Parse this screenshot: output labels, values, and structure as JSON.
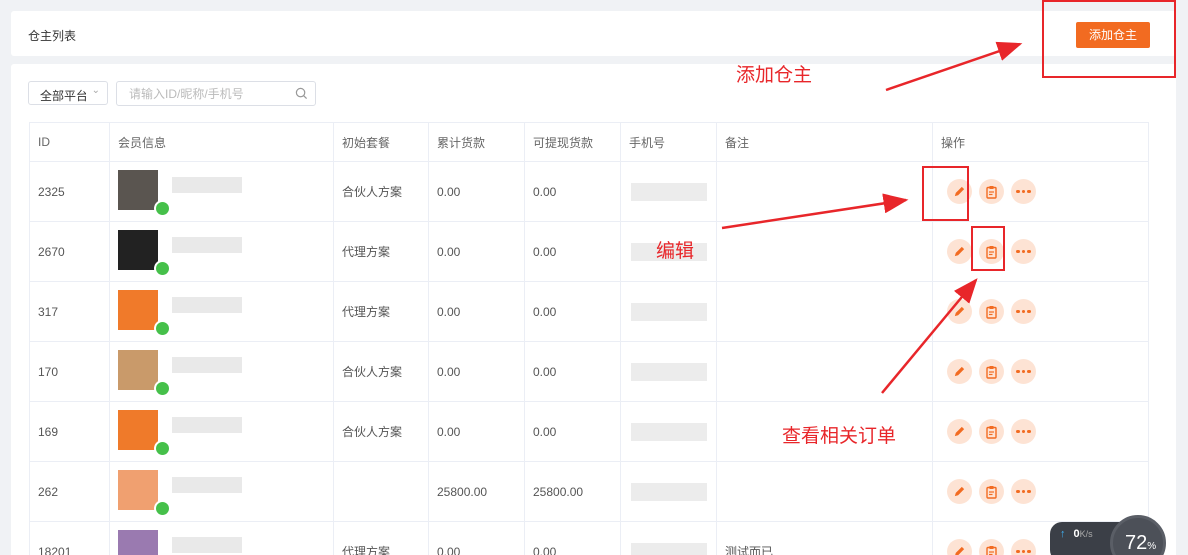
{
  "header": {
    "title": "仓主列表",
    "add_button": "添加仓主"
  },
  "filters": {
    "platform_value": "全部平台",
    "search_placeholder": "请输入ID/昵称/手机号"
  },
  "table": {
    "columns": [
      "ID",
      "会员信息",
      "初始套餐",
      "累计货款",
      "可提现货款",
      "手机号",
      "备注",
      "操作"
    ],
    "rows": [
      {
        "id": "2325",
        "plan": "合伙人方案",
        "total": "0.00",
        "withdrawable": "0.00",
        "note": ""
      },
      {
        "id": "2670",
        "plan": "代理方案",
        "total": "0.00",
        "withdrawable": "0.00",
        "note": ""
      },
      {
        "id": "317",
        "plan": "代理方案",
        "total": "0.00",
        "withdrawable": "0.00",
        "note": ""
      },
      {
        "id": "170",
        "plan": "合伙人方案",
        "total": "0.00",
        "withdrawable": "0.00",
        "note": ""
      },
      {
        "id": "169",
        "plan": "合伙人方案",
        "total": "0.00",
        "withdrawable": "0.00",
        "note": ""
      },
      {
        "id": "262",
        "plan": "",
        "total": "25800.00",
        "withdrawable": "25800.00",
        "note": ""
      },
      {
        "id": "18201",
        "plan": "代理方案",
        "total": "0.00",
        "withdrawable": "0.00",
        "note": "测试而已"
      }
    ]
  },
  "icons": {
    "edit": "pencil-icon",
    "orders": "clipboard-icon",
    "more": "more-dots-icon",
    "wechat": "wechat-icon",
    "search": "search-icon"
  },
  "annotations": {
    "add_owner": "添加仓主",
    "edit": "编辑",
    "view_orders": "查看相关订单"
  },
  "net_widget": {
    "upload": "0",
    "unit": "K/s",
    "percent": "72",
    "percent_sign": "%"
  },
  "colors": {
    "accent": "#f26b21",
    "annotation": "#e8262a",
    "op_bg": "#fde3d4"
  }
}
